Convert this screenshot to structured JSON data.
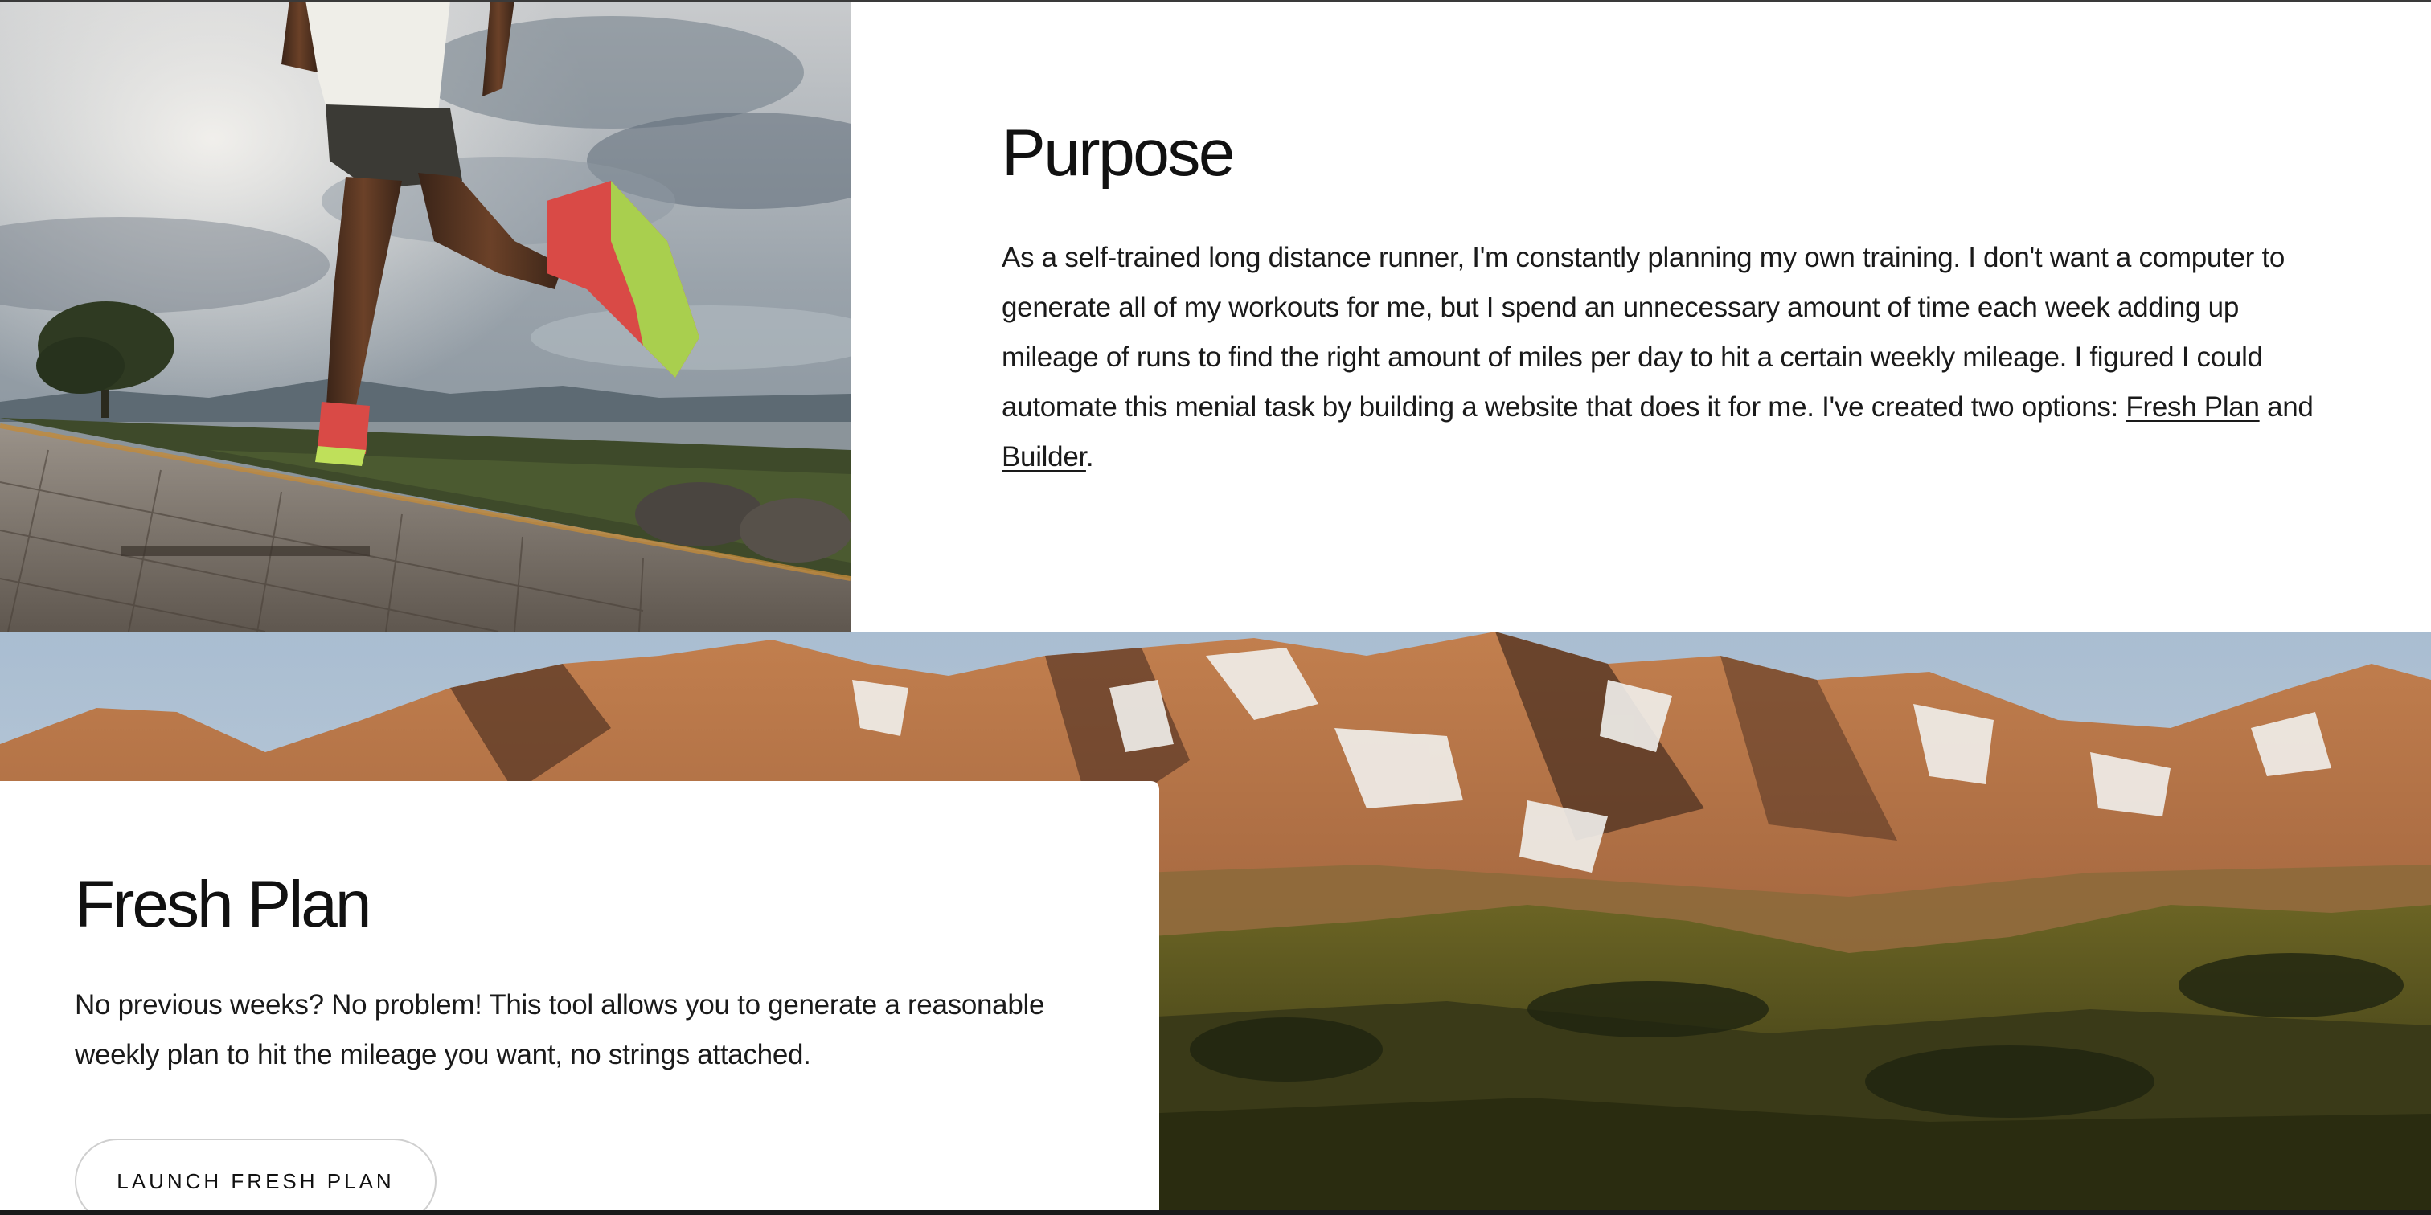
{
  "purpose": {
    "title": "Purpose",
    "body_text": "As a self-trained long distance runner, I'm constantly planning my own training. I don't want a computer to generate all of my workouts for me, but I spend an unnecessary amount of time each week adding up mileage of runs to find the right amount of miles per day to hit a certain weekly mileage. I figured I could automate this menial task by building a website that does it for me. I've created two options: ",
    "fresh_plan_link": "Fresh Plan",
    "connector": " and ",
    "builder_link": "Builder",
    "end_punct": "."
  },
  "fresh_plan": {
    "title": "Fresh Plan",
    "description": "No previous weeks? No problem! This tool allows you to generate a reasonable weekly plan to hit the mileage you want, no strings attached.",
    "button_label": "LAUNCH FRESH PLAN"
  },
  "images": {
    "runner": "runner-photo",
    "mountains": "mountain-photo"
  },
  "colors": {
    "text": "#111111",
    "background": "#ffffff",
    "button_border": "#cfcfcf"
  }
}
